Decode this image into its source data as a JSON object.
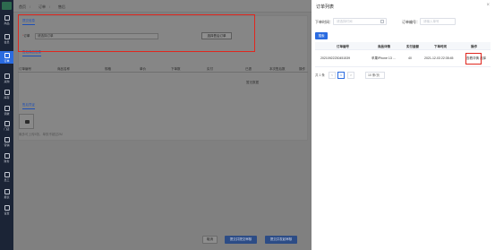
{
  "sidebar": {
    "items": [
      {
        "label": "商品",
        "icon": "box-icon"
      },
      {
        "label": "会员",
        "icon": "user-icon"
      },
      {
        "label": "订单",
        "icon": "order-icon",
        "active": true
      },
      {
        "label": "采购",
        "icon": "cart-icon"
      },
      {
        "label": "库存",
        "icon": "warehouse-icon"
      },
      {
        "label": "调拨",
        "icon": "transfer-icon"
      },
      {
        "label": "门店",
        "icon": "store-icon"
      },
      {
        "label": "营销",
        "icon": "marketing-icon"
      },
      {
        "label": "财务",
        "icon": "finance-icon"
      },
      {
        "label": "员工",
        "icon": "staff-icon"
      },
      {
        "label": "报表",
        "icon": "report-icon"
      },
      {
        "label": "设置",
        "icon": "settings-icon"
      }
    ]
  },
  "main": {
    "breadcrumb": [
      "首页",
      "订单",
      "售后"
    ],
    "section_tab": "提交信息",
    "order_label": "订单",
    "order_placeholder": "请选择订单",
    "select_order_button": "选择售后订单",
    "goods_tab": "售后商品信息",
    "columns": [
      "订单编号",
      "商品名称",
      "规格",
      "单价",
      "下单数",
      "实付",
      "已退",
      "本次售后数",
      "操作"
    ],
    "no_data": "暂无数据",
    "image_tab": "售后凭证",
    "upload_hint": "最多可上传5张，单张不超过2M",
    "buttons": {
      "cancel": "取消",
      "submit_review": "提交并提交审核",
      "submit": "提交并发起审核"
    }
  },
  "drawer": {
    "title": "订单列表",
    "close": "×",
    "filters": {
      "date_label": "下单时间：",
      "date_placeholder": "请选择时间",
      "order_no_label": "订单编号：",
      "order_no_placeholder": "请输入单号"
    },
    "search_button": "搜索",
    "table": {
      "columns": [
        "订单编号",
        "商品详情",
        "实付金额",
        "下单时间",
        "操作"
      ],
      "rows": [
        {
          "order_no": "20210922230451539",
          "goods": "苹果iPhone 13 …",
          "amount": "40",
          "time": "2021-12-03 22:35:45",
          "action_detail": "查看详情",
          "action_select": "选择"
        }
      ]
    },
    "pagination": {
      "total": "共 1 条",
      "page": "1",
      "page_size": "10 条/页",
      "prev": "<",
      "next": ">"
    }
  },
  "colors": {
    "accent": "#2a6be0",
    "highlight": "#e0271f",
    "sidebar_bg": "#1b2436"
  }
}
